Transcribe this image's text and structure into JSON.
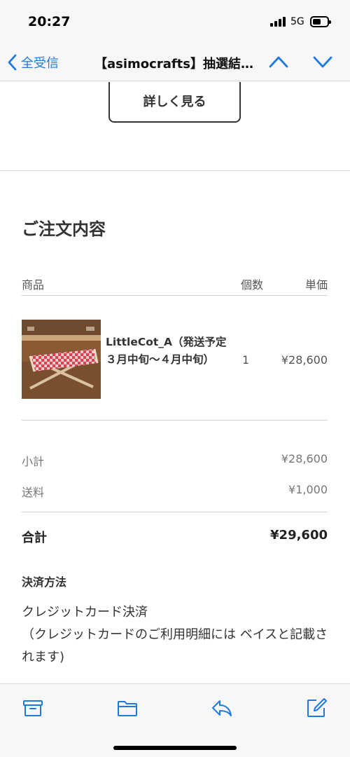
{
  "status_bar": {
    "time": "20:27",
    "network": "5G"
  },
  "nav": {
    "back_label": "全受信",
    "title": "【asimocrafts】抽選結果のお知らせ",
    "accent_color": "#1f7ae0"
  },
  "email": {
    "details_button": "詳しく見る",
    "order_title": "ご注文内容",
    "columns": {
      "product": "商品",
      "quantity": "個数",
      "unit_price": "単価"
    },
    "items": [
      {
        "name": "LittleCot_A（発送予定３月中旬〜４月中旬）",
        "quantity": "1",
        "price": "¥28,600",
        "image": "cot-photo"
      }
    ],
    "subtotal_label": "小計",
    "subtotal_value": "¥28,600",
    "shipping_label": "送料",
    "shipping_value": "¥1,000",
    "total_label": "合計",
    "total_value": "¥29,600",
    "payment_title": "決済方法",
    "payment_method": "クレジットカード決済",
    "payment_note": "（クレジットカードのご利用明細には ベイスと記載されます)"
  },
  "toolbar": {
    "icons": [
      "archive-icon",
      "folder-icon",
      "reply-icon",
      "compose-icon"
    ]
  }
}
